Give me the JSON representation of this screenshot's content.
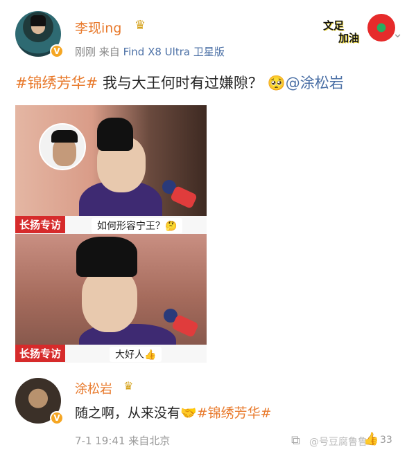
{
  "post": {
    "username": "李现ing",
    "time": "刚刚",
    "source_prefix": "来自",
    "device": "Find X8 Ultra 卫星版",
    "sticker_line1": "文足",
    "sticker_line2": "加油",
    "hashtag": "#锦绣芳华#",
    "text": " 我与大王何时有过嫌隙？",
    "emoji": "🥺",
    "mention": "@涂松岩"
  },
  "photos": [
    {
      "brand": "长扬专访",
      "caption": "如何形容宁王？🤔"
    },
    {
      "brand": "长扬专访",
      "caption": "大好人👍"
    }
  ],
  "comment": {
    "username": "涂松岩",
    "text": "随之啊，从来没有",
    "handshake": "🤝",
    "hashtag": "#锦绣芳华#",
    "timestamp": "7-1 19:41",
    "location": "来自北京",
    "watermark": "@号豆腐鲁鲁",
    "like_count": "33"
  },
  "colors": {
    "accent": "#e8792b",
    "link": "#4a6fa5",
    "brand_red": "#d62b2b"
  }
}
